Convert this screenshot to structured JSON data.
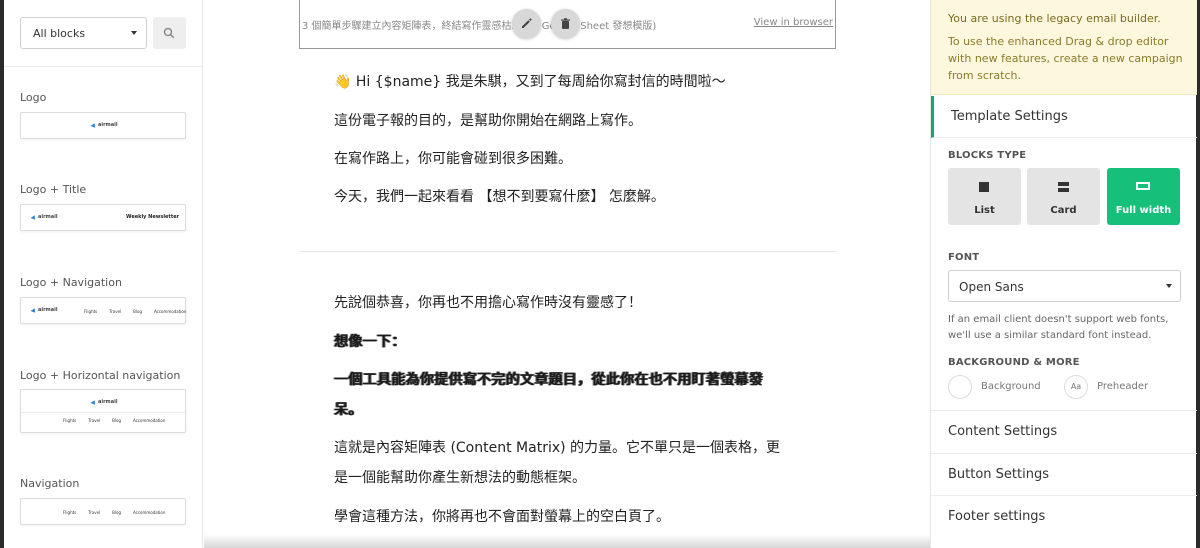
{
  "left_panel": {
    "blocks_select": {
      "value": "All blocks"
    },
    "groups": [
      {
        "label": "Logo",
        "logo_text": "airmail"
      },
      {
        "label": "Logo + Title",
        "logo_text": "airmail",
        "title_text": "Weekly Newsletter"
      },
      {
        "label": "Logo + Navigation",
        "logo_text": "airmail",
        "nav": [
          "Flights",
          "Travel",
          "Blog",
          "Accommodation"
        ]
      },
      {
        "label": "Logo + Horizontal navigation",
        "logo_text": "airmail",
        "nav": [
          "Flights",
          "Travel",
          "Blog",
          "Accommodation"
        ]
      },
      {
        "label": "Navigation",
        "nav": [
          "Flights",
          "Travel",
          "Blog",
          "Accommodation"
        ]
      }
    ]
  },
  "email": {
    "preheader": "3 個簡單步驟建立內容矩陣表，終結寫作靈感枯竭 (附 Google Sheet 發想模版)",
    "view_in_browser": "View in browser",
    "greeting_emoji": "👋",
    "lines_section1": [
      "Hi {$name} 我是朱騏，又到了每周給你寫封信的時間啦～",
      "這份電子報的目的，是幫助你開始在網路上寫作。",
      "在寫作路上，你可能會碰到很多困難。",
      "今天，我們一起來看看 【想不到要寫什麼】 怎麼解。"
    ],
    "lines_section2": [
      "先說個恭喜，你再也不用擔心寫作時沒有靈感了！",
      "想像一下：",
      "一個工具能為你提供寫不完的文章題目，從此你在也不用盯著螢幕發",
      "呆。",
      "這就是內容矩陣表 (Content Matrix) 的力量。它不單只是一個表格，更",
      "是一個能幫助你產生新想法的動態框架。",
      "學會這種方法，你將再也不會面對螢幕上的空白頁了。"
    ]
  },
  "right_panel": {
    "legacy_title": "You are using the legacy email builder.",
    "legacy_body": "To use the enhanced Drag & drop editor with new features, create a new campaign from scratch.",
    "template_settings": "Template Settings",
    "blocks_type_label": "BLOCKS TYPE",
    "block_types": [
      {
        "label": "List",
        "active": false
      },
      {
        "label": "Card",
        "active": false
      },
      {
        "label": "Full width",
        "active": true
      }
    ],
    "font_label": "FONT",
    "font_value": "Open Sans",
    "font_help": "If an email client doesn't support web fonts, we'll use a similar standard font instead.",
    "background_label": "BACKGROUND & MORE",
    "background_text": "Background",
    "preheader_badge": "Aa",
    "preheader_text": "Preheader",
    "sections": [
      "Content Settings",
      "Button Settings",
      "Footer settings"
    ]
  },
  "colors": {
    "accent_green": "#17c07a",
    "active_tab_bar": "#17a56b",
    "banner_bg": "#fdf8dd",
    "banner_text": "#8a7a2c"
  },
  "icons": [
    "search-icon",
    "pencil-icon",
    "trash-icon",
    "list-block-icon",
    "card-block-icon",
    "full-width-block-icon",
    "dropdown-caret-icon"
  ]
}
